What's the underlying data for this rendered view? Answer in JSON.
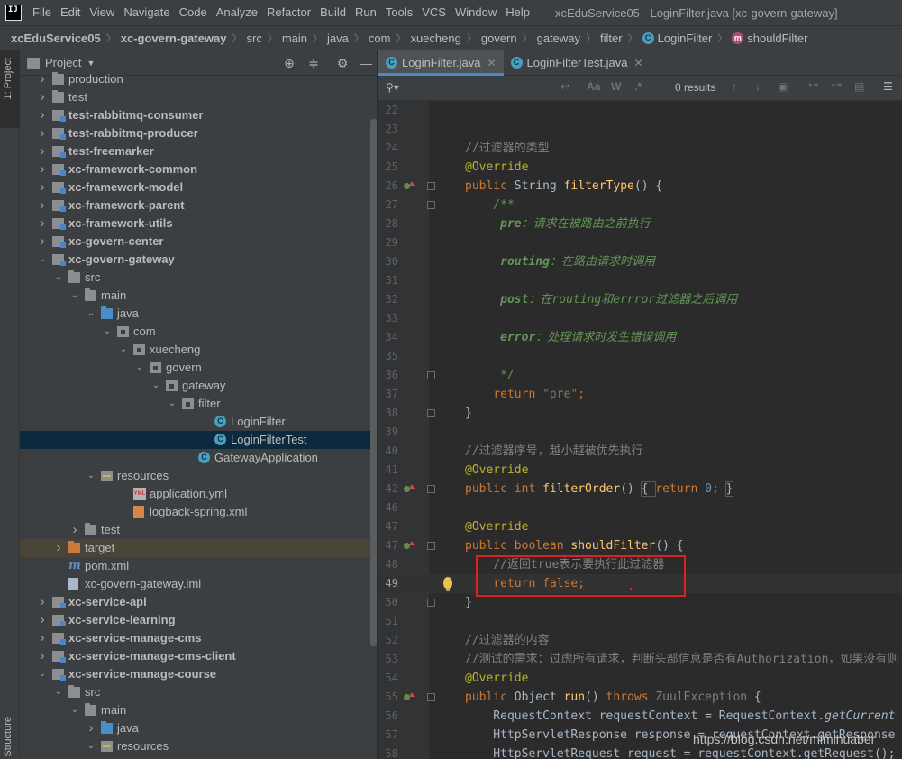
{
  "menubar": {
    "logo_text": "IJ",
    "items": [
      "File",
      "Edit",
      "View",
      "Navigate",
      "Code",
      "Analyze",
      "Refactor",
      "Build",
      "Run",
      "Tools",
      "VCS",
      "Window",
      "Help"
    ],
    "window_title": "xcEduService05 - LoginFilter.java [xc-govern-gateway]"
  },
  "breadcrumb": {
    "items": [
      "xcEduService05",
      "xc-govern-gateway",
      "src",
      "main",
      "java",
      "com",
      "xuecheng",
      "govern",
      "gateway",
      "filter",
      "LoginFilter",
      "shouldFilter"
    ]
  },
  "tool_stripe": {
    "project_label": "1: Project",
    "structure_label": "Structure"
  },
  "project_panel": {
    "title": "Project",
    "header_icons": [
      "locate-icon",
      "collapse-icon",
      "gear-icon",
      "minimize-icon"
    ],
    "tree": [
      {
        "label": "production",
        "depth": 1,
        "icon": "folder",
        "arrow": "right",
        "bold": false
      },
      {
        "label": "test",
        "depth": 1,
        "icon": "folder",
        "arrow": "right",
        "bold": false
      },
      {
        "label": "test-rabbitmq-consumer",
        "depth": 1,
        "icon": "module",
        "arrow": "right",
        "bold": true
      },
      {
        "label": "test-rabbitmq-producer",
        "depth": 1,
        "icon": "module",
        "arrow": "right",
        "bold": true
      },
      {
        "label": "test-freemarker",
        "depth": 1,
        "icon": "module",
        "arrow": "right",
        "bold": true
      },
      {
        "label": "xc-framework-common",
        "depth": 1,
        "icon": "module",
        "arrow": "right",
        "bold": true
      },
      {
        "label": "xc-framework-model",
        "depth": 1,
        "icon": "module",
        "arrow": "right",
        "bold": true
      },
      {
        "label": "xc-framework-parent",
        "depth": 1,
        "icon": "module",
        "arrow": "right",
        "bold": true
      },
      {
        "label": "xc-framework-utils",
        "depth": 1,
        "icon": "module",
        "arrow": "right",
        "bold": true
      },
      {
        "label": "xc-govern-center",
        "depth": 1,
        "icon": "module",
        "arrow": "right",
        "bold": true
      },
      {
        "label": "xc-govern-gateway",
        "depth": 1,
        "icon": "module",
        "arrow": "down",
        "bold": true
      },
      {
        "label": "src",
        "depth": 2,
        "icon": "folder",
        "arrow": "down",
        "bold": false
      },
      {
        "label": "main",
        "depth": 3,
        "icon": "folder",
        "arrow": "down",
        "bold": false
      },
      {
        "label": "java",
        "depth": 4,
        "icon": "src",
        "arrow": "down",
        "bold": false
      },
      {
        "label": "com",
        "depth": 5,
        "icon": "pkg",
        "arrow": "down",
        "bold": false
      },
      {
        "label": "xuecheng",
        "depth": 6,
        "icon": "pkg",
        "arrow": "down",
        "bold": false
      },
      {
        "label": "govern",
        "depth": 7,
        "icon": "pkg",
        "arrow": "down",
        "bold": false
      },
      {
        "label": "gateway",
        "depth": 8,
        "icon": "pkg",
        "arrow": "down",
        "bold": false
      },
      {
        "label": "filter",
        "depth": 9,
        "icon": "pkg",
        "arrow": "down",
        "bold": false
      },
      {
        "label": "LoginFilter",
        "depth": 11,
        "icon": "cls",
        "arrow": "",
        "bold": false
      },
      {
        "label": "LoginFilterTest",
        "depth": 11,
        "icon": "cls",
        "arrow": "",
        "bold": false,
        "selected": true
      },
      {
        "label": "GatewayApplication",
        "depth": 10,
        "icon": "cls",
        "arrow": "",
        "bold": false
      },
      {
        "label": "resources",
        "depth": 4,
        "icon": "res",
        "arrow": "down",
        "bold": false
      },
      {
        "label": "application.yml",
        "depth": 6,
        "icon": "yml",
        "arrow": "",
        "bold": false
      },
      {
        "label": "logback-spring.xml",
        "depth": 6,
        "icon": "xmlf",
        "arrow": "",
        "bold": false
      },
      {
        "label": "test",
        "depth": 3,
        "icon": "folder",
        "arrow": "right",
        "bold": false
      },
      {
        "label": "target",
        "depth": 2,
        "icon": "target",
        "arrow": "right",
        "bold": false,
        "target": true
      },
      {
        "label": "pom.xml",
        "depth": 2,
        "icon": "mvn",
        "arrow": "",
        "bold": false
      },
      {
        "label": "xc-govern-gateway.iml",
        "depth": 2,
        "icon": "iml",
        "arrow": "",
        "bold": false
      },
      {
        "label": "xc-service-api",
        "depth": 1,
        "icon": "module",
        "arrow": "right",
        "bold": true
      },
      {
        "label": "xc-service-learning",
        "depth": 1,
        "icon": "module",
        "arrow": "right",
        "bold": true
      },
      {
        "label": "xc-service-manage-cms",
        "depth": 1,
        "icon": "module",
        "arrow": "right",
        "bold": true
      },
      {
        "label": "xc-service-manage-cms-client",
        "depth": 1,
        "icon": "module",
        "arrow": "right",
        "bold": true
      },
      {
        "label": "xc-service-manage-course",
        "depth": 1,
        "icon": "module",
        "arrow": "down",
        "bold": true
      },
      {
        "label": "src",
        "depth": 2,
        "icon": "folder",
        "arrow": "down",
        "bold": false
      },
      {
        "label": "main",
        "depth": 3,
        "icon": "folder",
        "arrow": "down",
        "bold": false
      },
      {
        "label": "java",
        "depth": 4,
        "icon": "src",
        "arrow": "right",
        "bold": false
      },
      {
        "label": "resources",
        "depth": 4,
        "icon": "res",
        "arrow": "down",
        "bold": false
      }
    ]
  },
  "editor": {
    "tabs": [
      {
        "label": "LoginFilter.java",
        "active": true
      },
      {
        "label": "LoginFilterTest.java",
        "active": false
      }
    ],
    "find": {
      "placeholder": "",
      "value": "",
      "results": "0 results",
      "option_labels": [
        "Aa",
        "W",
        ".*"
      ]
    },
    "lines": [
      {
        "n": "22",
        "html": ""
      },
      {
        "n": "23",
        "html": ""
      },
      {
        "n": "24",
        "html": "<span class='cm'>//过滤器的类型</span>"
      },
      {
        "n": "25",
        "html": "<span class='an'>@Override</span>"
      },
      {
        "n": "26",
        "html": "<span class='k'>public </span>String <span class='fn'>filterType</span>() {",
        "marker": true,
        "fold": true
      },
      {
        "n": "27",
        "html": "    <span class='dc'>/**</span>",
        "fold": true,
        "docbox": true
      },
      {
        "n": "28",
        "html": "     <span class='dc-tag'>pre</span><span class='dc'>：请求在被路由之前执行</span>"
      },
      {
        "n": "29",
        "html": ""
      },
      {
        "n": "30",
        "html": "     <span class='dc-tag'>routing</span><span class='dc'>：在路由请求时调用</span>"
      },
      {
        "n": "31",
        "html": ""
      },
      {
        "n": "32",
        "html": "     <span class='dc-tag'>post</span><span class='dc'>：在routing和errror过滤器之后调用</span>"
      },
      {
        "n": "33",
        "html": ""
      },
      {
        "n": "34",
        "html": "     <span class='dc-tag'>error</span><span class='dc'>：处理请求时发生错误调用</span>"
      },
      {
        "n": "35",
        "html": ""
      },
      {
        "n": "36",
        "html": "     <span class='dc'>*/</span>",
        "fold": true
      },
      {
        "n": "37",
        "html": "    <span class='k'>return </span><span class='st'>\"pre\"</span><span class='k'>;</span>"
      },
      {
        "n": "38",
        "html": "}",
        "fold": true
      },
      {
        "n": "39",
        "html": ""
      },
      {
        "n": "40",
        "html": "<span class='cm'>//过滤器序号，越小越被优先执行</span>"
      },
      {
        "n": "41",
        "html": "<span class='an'>@Override</span>"
      },
      {
        "n": "42",
        "html": "<span class='k'>public int </span><span class='fn'>filterOrder</span>() <span class='bx'>{ </span><span class='k'>return </span><span style='color:#6897bb'>0</span><span class='k'>; </span><span class='bx'>}</span>",
        "marker": true,
        "fold": true
      },
      {
        "n": "46",
        "html": ""
      },
      {
        "n": "47",
        "html": "<span class='an'>@Override</span>"
      },
      {
        "n": "47",
        "html": "<span class='k'>public boolean </span><span class='fn'>shouldFilter</span>() {",
        "marker": true,
        "fold": true
      },
      {
        "n": "48",
        "html": "    <span class='cm'>//返回true表示要执行此过滤器</span>"
      },
      {
        "n": "49",
        "html": "    <span class='k'>return false</span><span class='k'>;</span>",
        "current": true,
        "bulb": true
      },
      {
        "n": "50",
        "html": "}",
        "fold": true
      },
      {
        "n": "51",
        "html": ""
      },
      {
        "n": "52",
        "html": "<span class='cm'>//过滤器的内容</span>"
      },
      {
        "n": "53",
        "html": "<span class='cm'>//测试的需求：过虑所有请求，判断头部信息是否有Authorization，如果没有则</span>"
      },
      {
        "n": "54",
        "html": "<span class='an'>@Override</span>"
      },
      {
        "n": "55",
        "html": "<span class='k'>public </span>Object <span class='fn'>run</span>() <span class='k'>throws </span><span style='color:#808080'>ZuulException</span> {",
        "marker": true,
        "fold": true
      },
      {
        "n": "56",
        "html": "    RequestContext requestContext = RequestContext.<span class='it'>getCurrent</span>"
      },
      {
        "n": "57",
        "html": "    HttpServletResponse response = requestContext.getResponse"
      },
      {
        "n": "58",
        "html": "    HttpServletRequest request = requestContext.getRequest();"
      }
    ]
  },
  "watermark": "https://blog.csdn.net/mimihuaber"
}
